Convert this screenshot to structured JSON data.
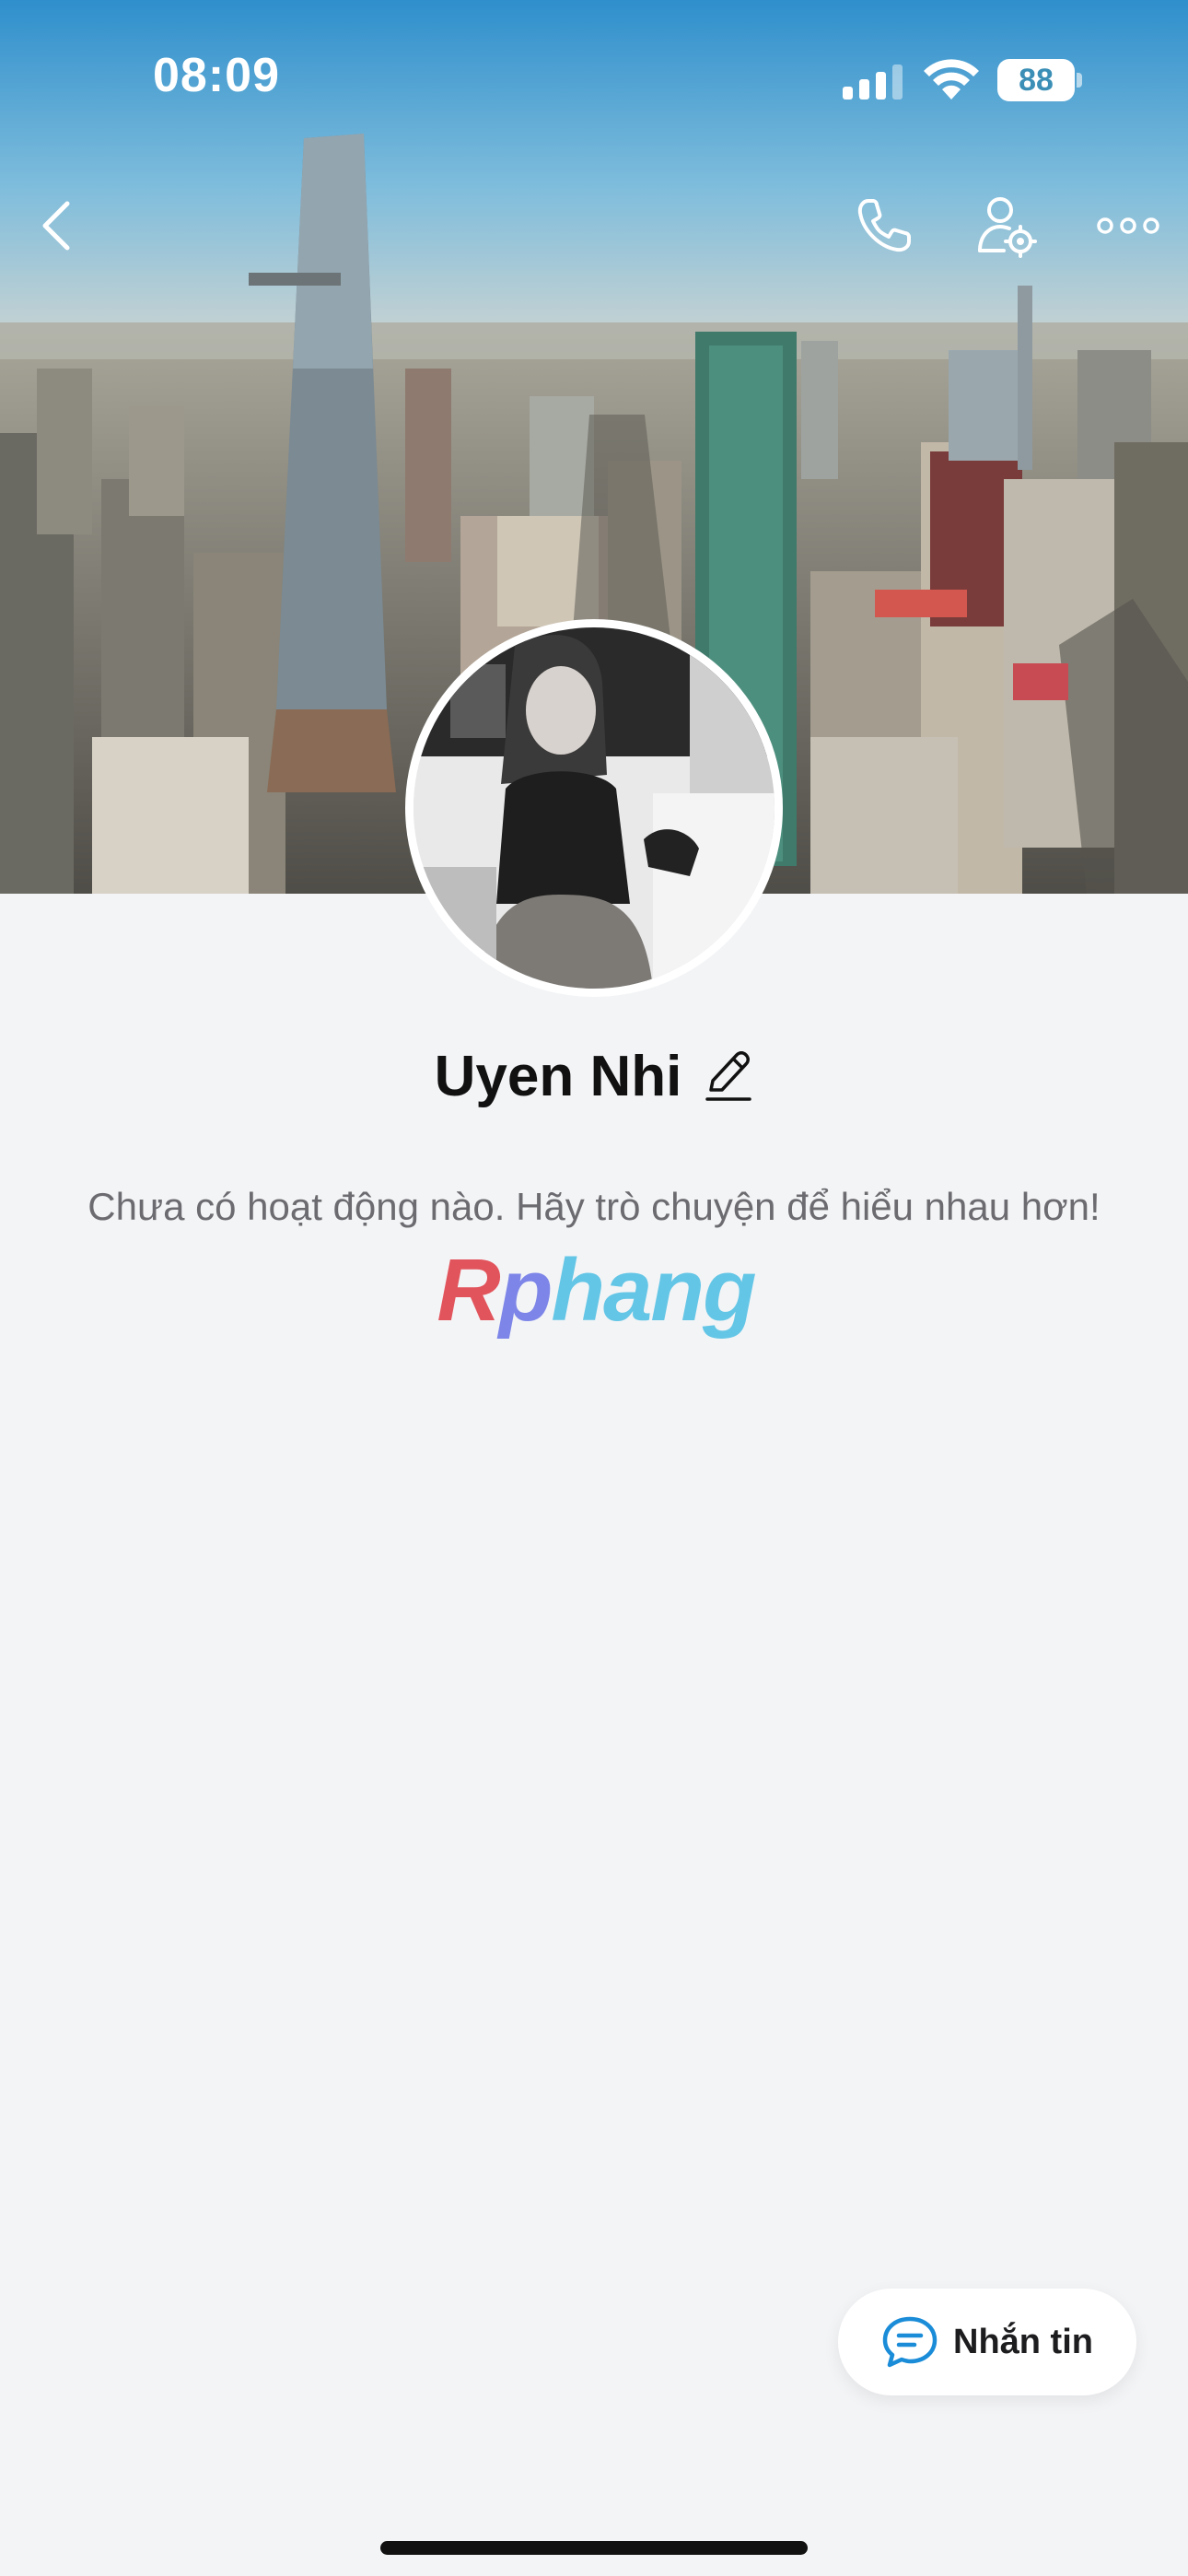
{
  "status_bar": {
    "time": "08:09",
    "battery_level": "88"
  },
  "nav": {
    "back_icon": "chevron-left-icon",
    "call_icon": "phone-icon",
    "settings_icon": "person-settings-icon",
    "more_icon": "ellipsis-icon"
  },
  "profile": {
    "name": "Uyen Nhi",
    "edit_icon": "pencil-icon",
    "empty_state": "Chưa có hoạt động nào. Hãy trò chuyện để hiểu nhau hơn!"
  },
  "watermark": {
    "first": "R",
    "second": "p",
    "rest": "hang"
  },
  "message_button": {
    "label": "Nhắn tin",
    "icon": "chat-bubble-icon"
  },
  "colors": {
    "background": "#f3f4f6",
    "accent_blue": "#1a8cd8",
    "text_primary": "#111111",
    "text_secondary": "#6c6c70"
  }
}
